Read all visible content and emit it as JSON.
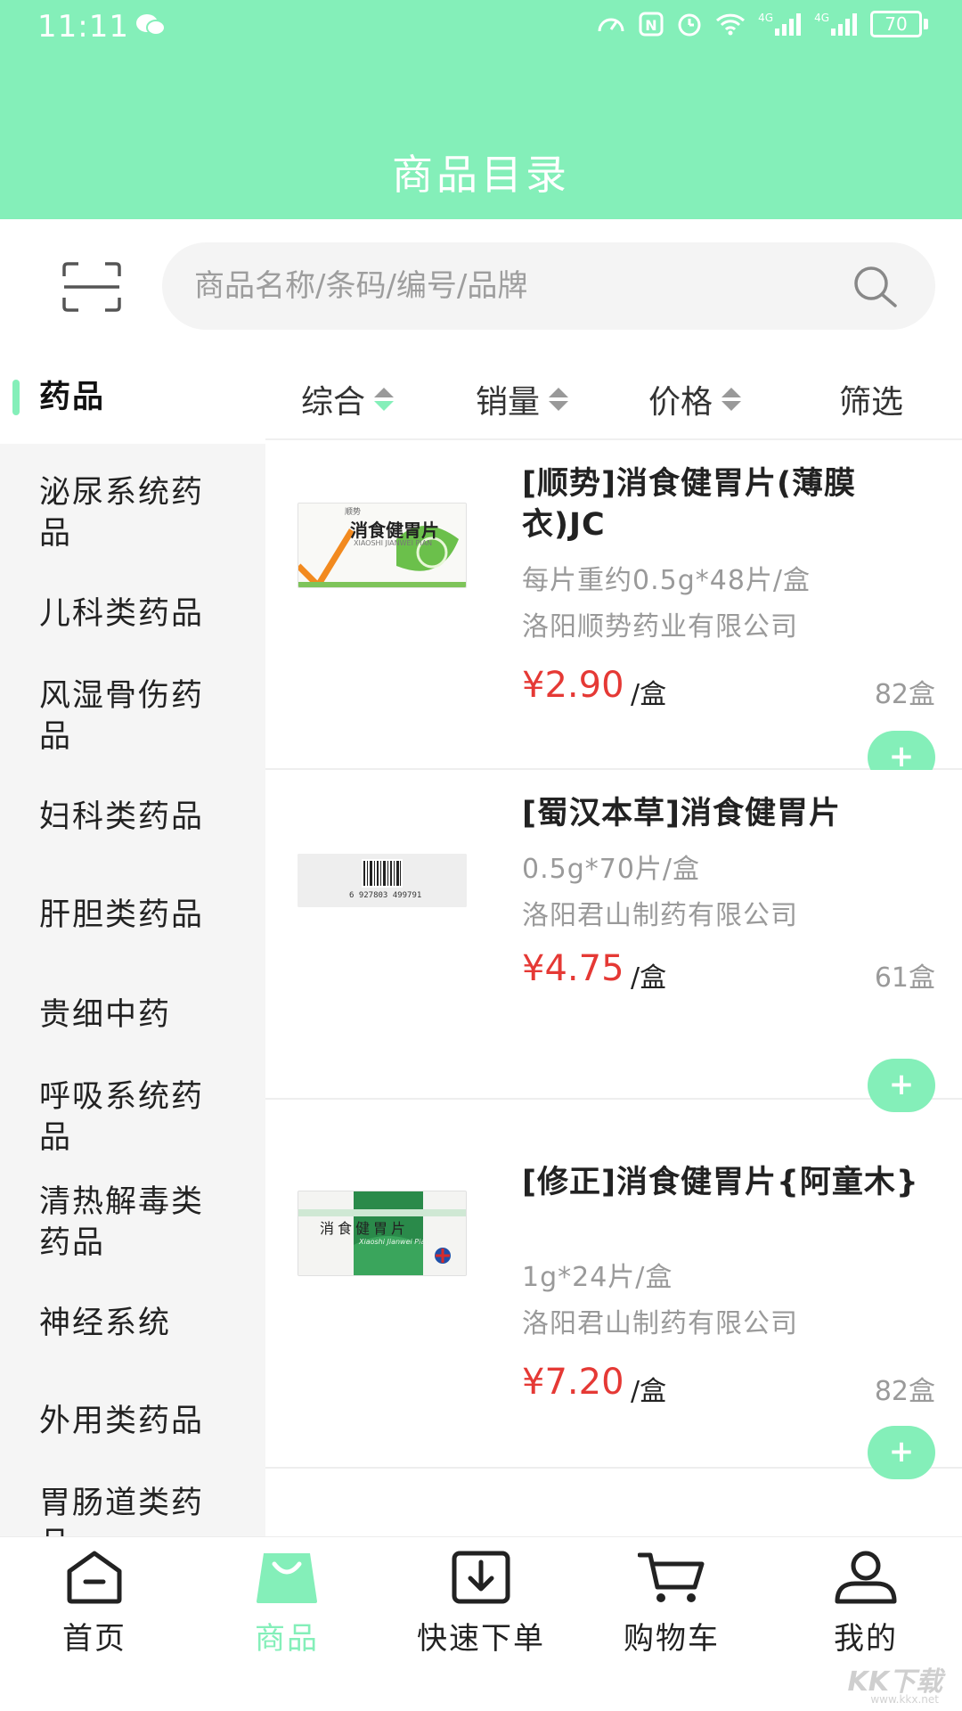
{
  "status": {
    "time": "11:11",
    "signal_1": "4G",
    "signal_2": "4G",
    "battery": "70"
  },
  "header": {
    "title": "商品目录"
  },
  "search": {
    "placeholder": "商品名称/条码/编号/品牌"
  },
  "sort": {
    "items": [
      "综合",
      "销量",
      "价格",
      "筛选"
    ]
  },
  "sidebar": {
    "items": [
      {
        "label": "药品"
      },
      {
        "label": "泌尿系统药品"
      },
      {
        "label": "儿科类药品"
      },
      {
        "label": "风湿骨伤药品"
      },
      {
        "label": "妇科类药品"
      },
      {
        "label": "肝胆类药品"
      },
      {
        "label": "贵细中药"
      },
      {
        "label": "呼吸系统药品"
      },
      {
        "label": "清热解毒类药品"
      },
      {
        "label": "神经系统"
      },
      {
        "label": "外用类药品"
      },
      {
        "label": "胃肠道类药品"
      }
    ]
  },
  "products": [
    {
      "name": "[顺势]消食健胃片(薄膜衣)JC",
      "spec": "每片重约0.5g*48片/盒",
      "maker": "洛阳顺势药业有限公司",
      "price": "¥2.90",
      "unit": "/盒",
      "stock": "82盒",
      "add": "+",
      "box_title": "消食健胃片",
      "box_pinyin": "XIAOSHI JIANWEI PIAN",
      "box_brand": "顺势"
    },
    {
      "name": "[蜀汉本草]消食健胃片",
      "spec": "0.5g*70片/盒",
      "maker": "洛阳君山制药有限公司",
      "price": "¥4.75",
      "unit": "/盒",
      "stock": "61盒",
      "add": "+",
      "barcode": "6 927803 499791"
    },
    {
      "name": "[修正]消食健胃片{阿童木}",
      "spec": "1g*24片/盒",
      "maker": "洛阳君山制药有限公司",
      "price": "¥7.20",
      "unit": "/盒",
      "stock": "82盒",
      "add": "+",
      "box_title": "消食健胃片",
      "box_pinyin": "Xiaoshi Jianwei Pian"
    }
  ],
  "tabbar": {
    "items": [
      {
        "label": "首页",
        "icon": "home-icon"
      },
      {
        "label": "商品",
        "icon": "shopping-bag-icon"
      },
      {
        "label": "快速下单",
        "icon": "download-box-icon"
      },
      {
        "label": "购物车",
        "icon": "cart-icon"
      },
      {
        "label": "我的",
        "icon": "user-icon"
      }
    ],
    "active": "商品"
  },
  "watermark": {
    "text": "KK下载",
    "url": "www.kkx.net"
  },
  "colors": {
    "accent": "#84efb9",
    "price": "#e53935",
    "sidebar_bg": "#f5f5f5"
  }
}
